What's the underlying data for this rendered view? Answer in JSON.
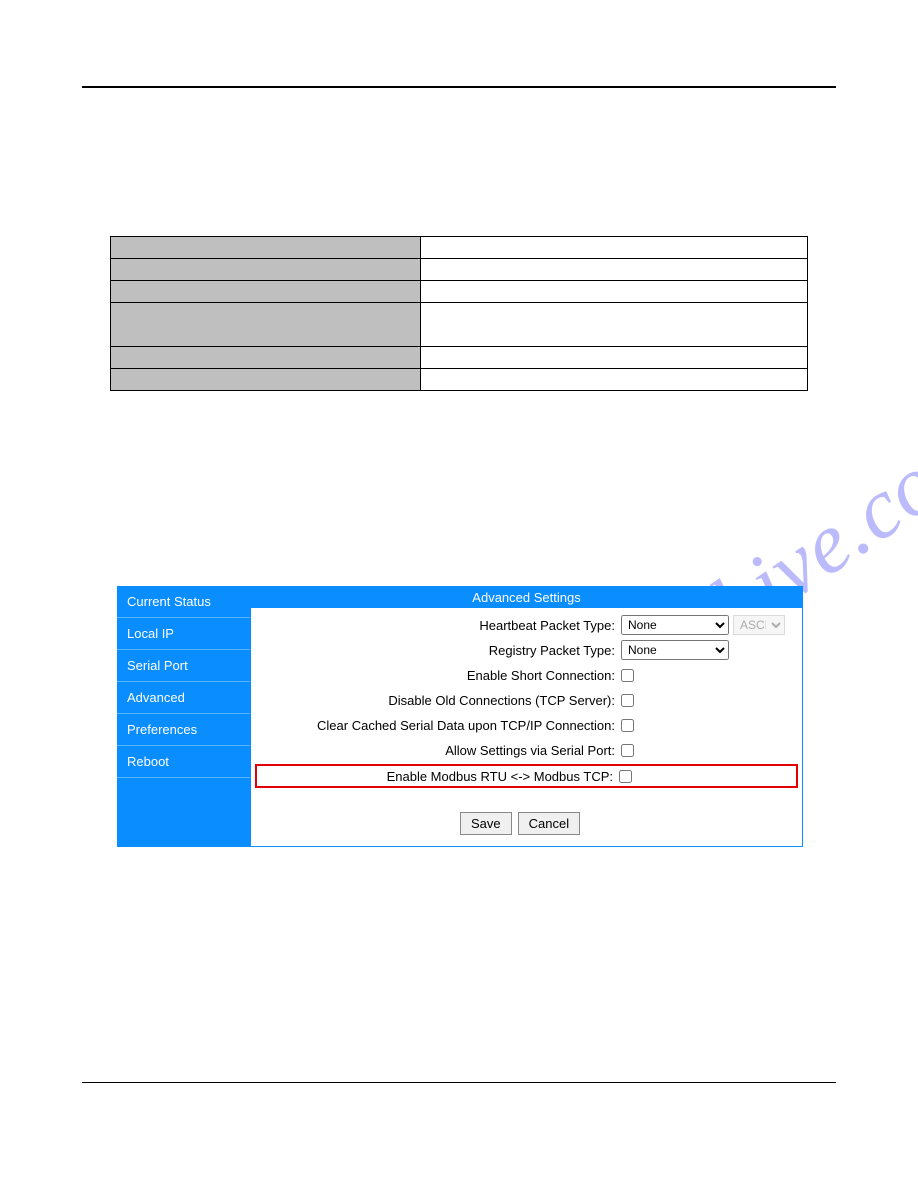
{
  "watermark": "manualshive.com",
  "sidebar": {
    "items": [
      {
        "label": "Current Status"
      },
      {
        "label": "Local IP"
      },
      {
        "label": "Serial Port"
      },
      {
        "label": "Advanced"
      },
      {
        "label": "Preferences"
      },
      {
        "label": "Reboot"
      }
    ]
  },
  "panel": {
    "title": "Advanced Settings",
    "rows": {
      "heartbeat_label": "Heartbeat Packet Type:",
      "heartbeat_value": "None",
      "ascii_label": "ASCII",
      "registry_label": "Registry Packet Type:",
      "registry_value": "None",
      "short_conn_label": "Enable Short Connection:",
      "disable_old_label": "Disable Old Connections (TCP Server):",
      "clear_cache_label": "Clear Cached Serial Data upon TCP/IP Connection:",
      "allow_serial_label": "Allow Settings via Serial Port:",
      "modbus_label": "Enable Modbus RTU <-> Modbus TCP:"
    }
  },
  "buttons": {
    "save": "Save",
    "cancel": "Cancel"
  }
}
